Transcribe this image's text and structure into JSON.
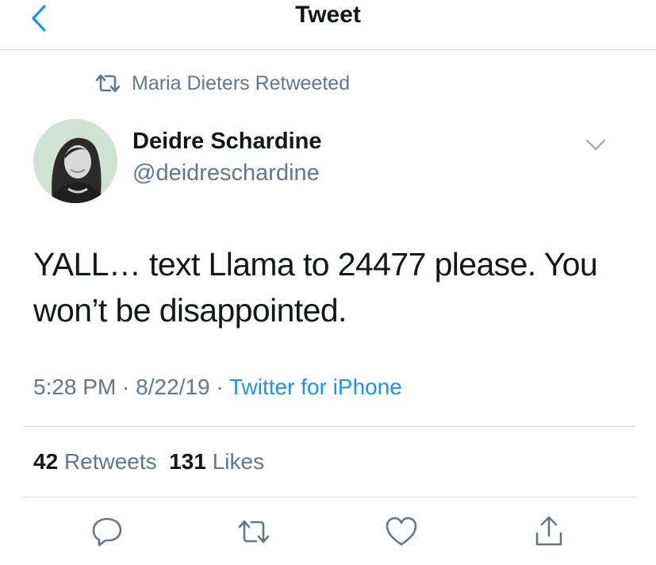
{
  "nav": {
    "title": "Tweet"
  },
  "retweet_context": {
    "text": "Maria Dieters Retweeted",
    "icon": "retweet-icon"
  },
  "author": {
    "display_name": "Deidre Schardine",
    "handle": "@deidreschardine"
  },
  "tweet": {
    "text": "YALL… text Llama to 24477 please. You won’t be disappointed."
  },
  "meta": {
    "time": "5:28 PM",
    "sep1": " · ",
    "date": "8/22/19",
    "sep2": " · ",
    "source": "Twitter for iPhone"
  },
  "stats": {
    "retweets_count": "42",
    "retweets_label": "Retweets",
    "likes_count": "131",
    "likes_label": "Likes"
  },
  "actions": [
    "reply-icon",
    "retweet-icon",
    "like-icon",
    "share-icon"
  ],
  "colors": {
    "accent": "#1b95e0",
    "text_primary": "#14171a",
    "text_secondary": "#657786",
    "divider": "#d8dbde"
  }
}
